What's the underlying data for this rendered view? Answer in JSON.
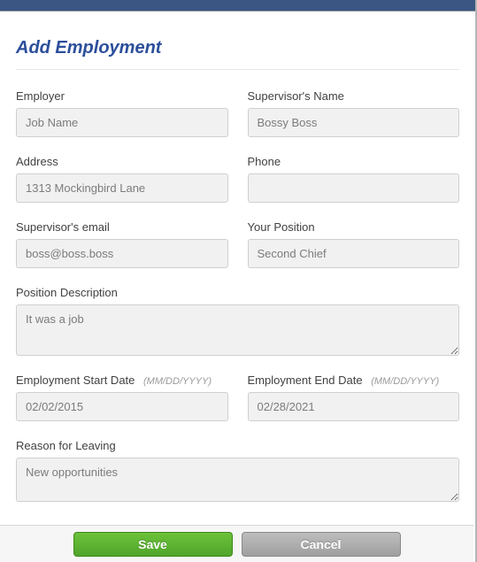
{
  "title": "Add Employment",
  "fields": {
    "employer": {
      "label": "Employer",
      "value": "Job Name"
    },
    "supervisor": {
      "label": "Supervisor's Name",
      "value": "Bossy Boss"
    },
    "address": {
      "label": "Address",
      "value": "1313 Mockingbird Lane"
    },
    "phone": {
      "label": "Phone",
      "value": ""
    },
    "sup_email": {
      "label": "Supervisor's email",
      "value": "boss@boss.boss"
    },
    "position": {
      "label": "Your Position",
      "value": "Second Chief"
    },
    "pos_desc": {
      "label": "Position Description",
      "value": "It was a job"
    },
    "start_date": {
      "label": "Employment Start Date",
      "hint": "(MM/DD/YYYY)",
      "value": "02/02/2015"
    },
    "end_date": {
      "label": "Employment End Date",
      "hint": "(MM/DD/YYYY)",
      "value": "02/28/2021"
    },
    "reason": {
      "label": "Reason for Leaving",
      "value": "New opportunities"
    }
  },
  "buttons": {
    "save": "Save",
    "cancel": "Cancel"
  }
}
